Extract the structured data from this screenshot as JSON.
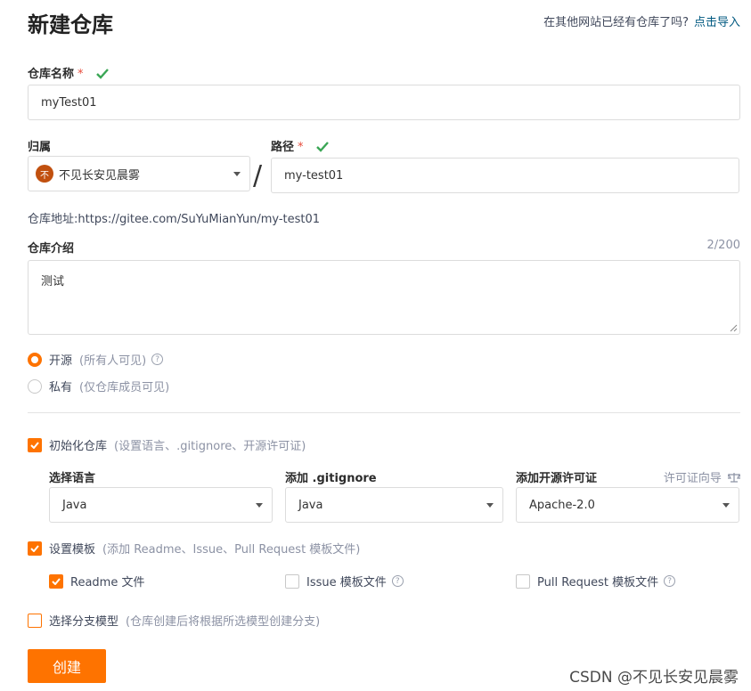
{
  "page": {
    "title": "新建仓库",
    "import_prompt": "在其他网站已经有仓库了吗?",
    "import_link": "点击导入"
  },
  "repo_name": {
    "label": "仓库名称",
    "required_mark": "*",
    "value": "myTest01"
  },
  "owner": {
    "label": "归属",
    "avatar_text": "不",
    "value": "不见长安见晨雾"
  },
  "separator": "/",
  "path": {
    "label": "路径",
    "required_mark": "*",
    "value": "my-test01"
  },
  "repo_address": {
    "text": "仓库地址:https://gitee.com/SuYuMianYun/my-test01"
  },
  "description": {
    "label": "仓库介绍",
    "counter": "2/200",
    "value": "测试"
  },
  "visibility": {
    "options": [
      {
        "label": "开源",
        "hint": "(所有人可见)",
        "selected": true
      },
      {
        "label": "私有",
        "hint": "(仅仓库成员可见)",
        "selected": false
      }
    ]
  },
  "init_repo": {
    "label": "初始化仓库",
    "hint": "(设置语言、.gitignore、开源许可证)",
    "checked": true
  },
  "language": {
    "label": "选择语言",
    "value": "Java"
  },
  "gitignore": {
    "label": "添加 .gitignore",
    "value": "Java"
  },
  "license": {
    "label": "添加开源许可证",
    "guide": "许可证向导",
    "value": "Apache-2.0"
  },
  "template": {
    "label": "设置模板",
    "hint": "(添加 Readme、Issue、Pull Request 模板文件)",
    "checked": true
  },
  "template_files": [
    {
      "label": "Readme 文件",
      "checked": true
    },
    {
      "label": "Issue 模板文件",
      "checked": false
    },
    {
      "label": "Pull Request 模板文件",
      "checked": false
    }
  ],
  "branch_model": {
    "label": "选择分支模型",
    "hint": "(仓库创建后将根据所选模型创建分支)",
    "checked": false
  },
  "create_button": "创建",
  "watermark": "CSDN @不见长安见晨雾",
  "colors": {
    "accent": "#fe7300",
    "link": "#005980",
    "ok": "#3aa655",
    "required": "#e74c3c"
  }
}
